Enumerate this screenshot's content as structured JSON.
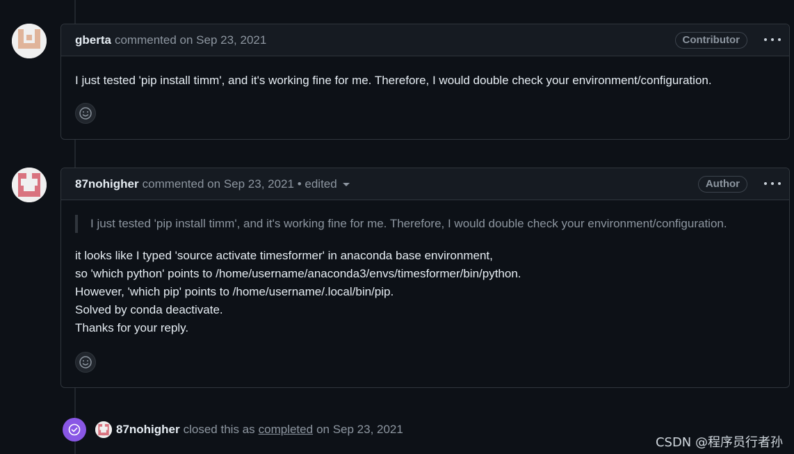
{
  "comments": [
    {
      "author": "gberta",
      "action": "commented on",
      "timestamp": "Sep 23, 2021",
      "edited": "",
      "role": "Contributor",
      "body": "I just tested 'pip install timm', and it's working fine for me. Therefore, I would double check your environment/configuration."
    },
    {
      "author": "87nohigher",
      "action": "commented on",
      "timestamp": "Sep 23, 2021",
      "edited": "• edited",
      "role": "Author",
      "quote": "I just tested 'pip install timm', and it's working fine for me. Therefore, I would double check your environment/configuration.",
      "lines": [
        "it looks like I typed 'source activate timesformer' in anaconda base environment,",
        "so 'which python' points to /home/username/anaconda3/envs/timesformer/bin/python.",
        "However, 'which pip' points to /home/username/.local/bin/pip.",
        "Solved by conda deactivate.",
        "Thanks for your reply."
      ]
    }
  ],
  "event": {
    "author": "87nohigher",
    "text_before": "closed this as",
    "link": "completed",
    "text_after": "on Sep 23, 2021"
  },
  "watermark": "CSDN @程序员行者孙",
  "icons": {
    "kebab": "kebab-horizontal-icon",
    "reaction": "smiley-icon",
    "closed": "check-circle-icon",
    "caret": "triangle-down-icon"
  },
  "colors": {
    "background": "#0d1117",
    "header": "#161b22",
    "border": "#30363d",
    "muted": "#8d96a0",
    "closed_purple": "#8957e5"
  }
}
